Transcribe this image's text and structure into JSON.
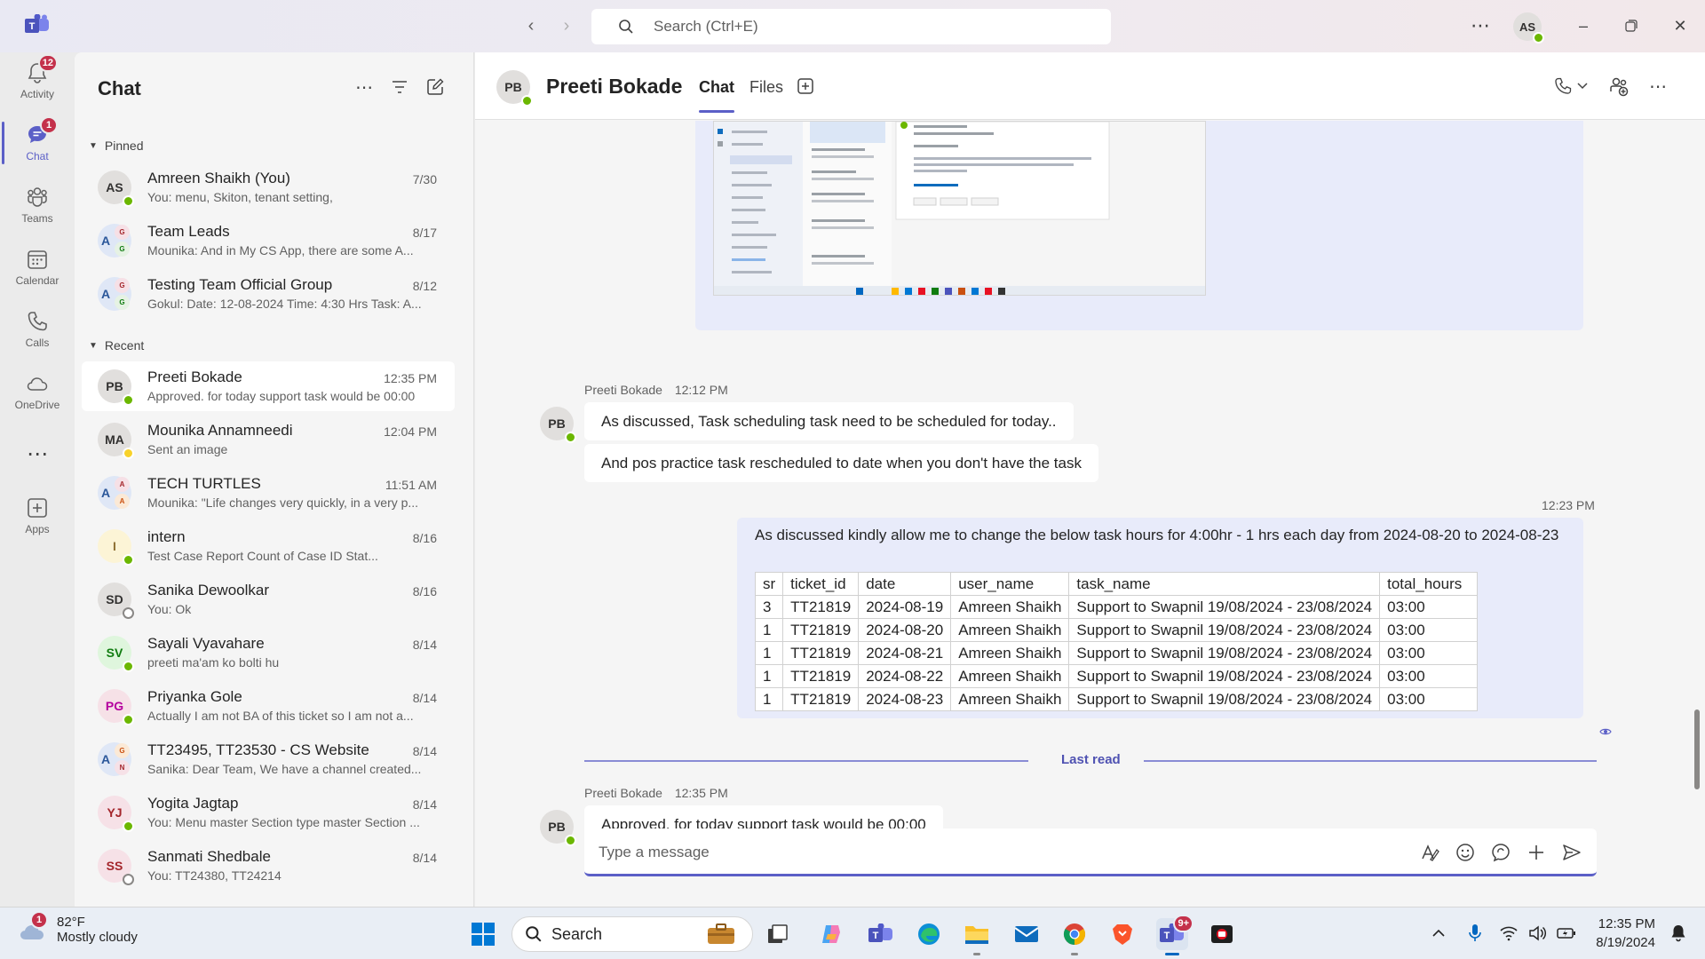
{
  "titlebar": {
    "search_placeholder": "Search (Ctrl+E)",
    "user_initials": "AS"
  },
  "rail": {
    "items": [
      {
        "label": "Activity",
        "icon": "bell-icon",
        "badge": "12"
      },
      {
        "label": "Chat",
        "icon": "chat-icon",
        "badge": "1"
      },
      {
        "label": "Teams",
        "icon": "teams-icon"
      },
      {
        "label": "Calendar",
        "icon": "calendar-icon"
      },
      {
        "label": "Calls",
        "icon": "phone-icon"
      },
      {
        "label": "OneDrive",
        "icon": "cloud-icon"
      },
      {
        "label": "Apps",
        "icon": "apps-icon"
      }
    ]
  },
  "chatlist": {
    "title": "Chat",
    "pinned_label": "Pinned",
    "recent_label": "Recent",
    "pinned": [
      {
        "initials": "AS",
        "name": "Amreen Shaikh (You)",
        "time": "7/30",
        "preview": "You: menu, Skiton, tenant setting,"
      },
      {
        "initials": "A",
        "name": "Team Leads",
        "time": "8/17",
        "preview": "Mounika: And in My CS App, there are some A..."
      },
      {
        "initials": "A",
        "name": "Testing Team Official Group",
        "time": "8/12",
        "preview": "Gokul: Date: 12-08-2024 Time: 4:30 Hrs Task: A..."
      }
    ],
    "recent": [
      {
        "initials": "PB",
        "name": "Preeti Bokade",
        "time": "12:35 PM",
        "preview": "Approved. for today support task would be 00:00"
      },
      {
        "initials": "MA",
        "name": "Mounika Annamneedi",
        "time": "12:04 PM",
        "preview": "Sent an image"
      },
      {
        "initials": "A",
        "name": "TECH TURTLES",
        "time": "11:51 AM",
        "preview": "Mounika: \"Life changes very quickly, in a very p..."
      },
      {
        "initials": "I",
        "name": "intern",
        "time": "8/16",
        "preview": "Test Case Report          Count of Case ID Stat..."
      },
      {
        "initials": "SD",
        "name": "Sanika Dewoolkar",
        "time": "8/16",
        "preview": "You: Ok"
      },
      {
        "initials": "SV",
        "name": "Sayali Vyavahare",
        "time": "8/14",
        "preview": "preeti ma'am ko bolti hu"
      },
      {
        "initials": "PG",
        "name": "Priyanka Gole",
        "time": "8/14",
        "preview": "Actually I am not BA of this ticket so I am not a..."
      },
      {
        "initials": "A",
        "name": "TT23495, TT23530 - CS Website",
        "time": "8/14",
        "preview": "Sanika: Dear Team,   We have a channel created..."
      },
      {
        "initials": "YJ",
        "name": "Yogita Jagtap",
        "time": "8/14",
        "preview": "You: Menu master Section type master Section ..."
      },
      {
        "initials": "SS",
        "name": "Sanmati Shedbale",
        "time": "8/14",
        "preview": "You: TT24380, TT24214"
      }
    ]
  },
  "header": {
    "initials": "PB",
    "name": "Preeti Bokade",
    "tabs": [
      "Chat",
      "Files"
    ]
  },
  "messages": {
    "group1": {
      "sender": "Preeti Bokade",
      "time": "12:12 PM",
      "avatar": "PB",
      "lines": [
        "As discussed, Task scheduling task need to be scheduled for today..",
        "And pos practice task rescheduled to date when you don't have the task"
      ]
    },
    "outgoing": {
      "time": "12:23 PM",
      "text": "As discussed kindly allow me to change the below task hours for 4:00hr - 1 hrs each day from 2024-08-20 to 2024-08-23",
      "table": {
        "headers": [
          "sr",
          "ticket_id",
          "date",
          "user_name",
          "task_name",
          "total_hours"
        ],
        "rows": [
          [
            "3",
            "TT21819",
            "2024-08-19",
            "Amreen Shaikh",
            "Support to Swapnil 19/08/2024 - 23/08/2024",
            "03:00"
          ],
          [
            "1",
            "TT21819",
            "2024-08-20",
            "Amreen Shaikh",
            "Support to Swapnil 19/08/2024 - 23/08/2024",
            "03:00"
          ],
          [
            "1",
            "TT21819",
            "2024-08-21",
            "Amreen Shaikh",
            "Support to Swapnil 19/08/2024 - 23/08/2024",
            "03:00"
          ],
          [
            "1",
            "TT21819",
            "2024-08-22",
            "Amreen Shaikh",
            "Support to Swapnil 19/08/2024 - 23/08/2024",
            "03:00"
          ],
          [
            "1",
            "TT21819",
            "2024-08-23",
            "Amreen Shaikh",
            "Support to Swapnil 19/08/2024 - 23/08/2024",
            "03:00"
          ]
        ]
      }
    },
    "last_read": "Last read",
    "group2": {
      "sender": "Preeti Bokade",
      "time": "12:35 PM",
      "avatar": "PB",
      "lines": [
        "Approved. for today support task would be 00:00"
      ]
    }
  },
  "compose": {
    "placeholder": "Type a message"
  },
  "taskbar": {
    "weather_badge": "1",
    "temperature": "82°F",
    "condition": "Mostly cloudy",
    "search_label": "Search",
    "teams_badge": "9+",
    "time": "12:35 PM",
    "date": "8/19/2024"
  },
  "colors": {
    "accent": "#5b5fc7",
    "outgoing_bubble": "#e8ebfa",
    "presence_available": "#6bb700",
    "badge": "#c4314b"
  }
}
